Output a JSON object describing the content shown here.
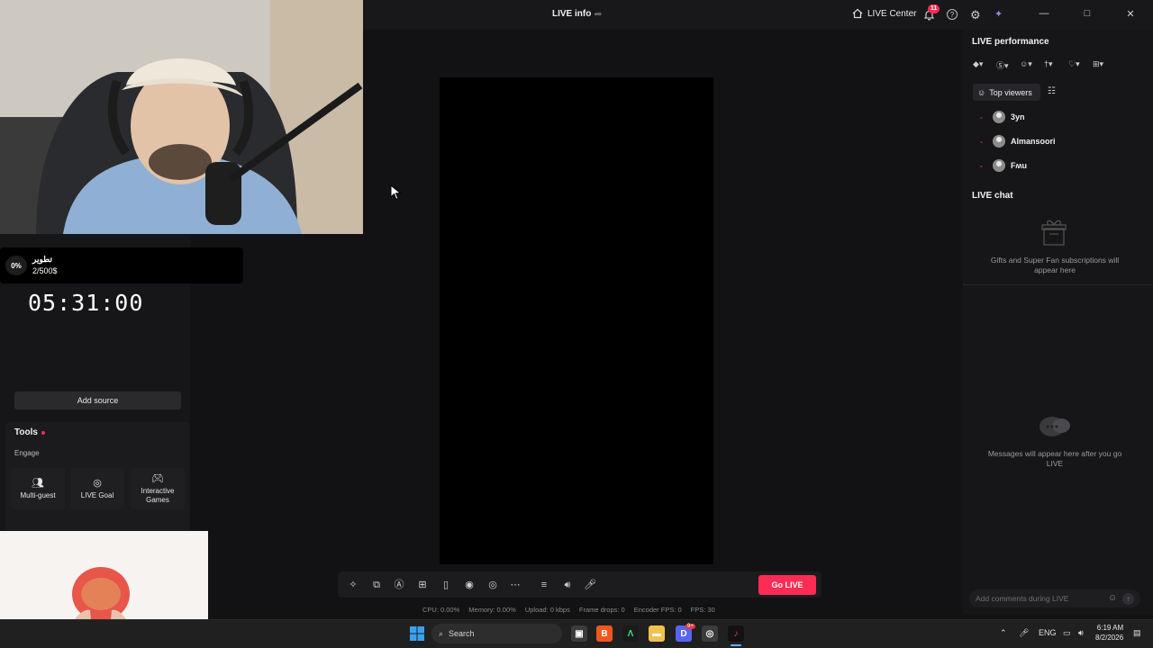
{
  "window": {
    "title": "LIVE info",
    "live_center_label": "LIVE Center",
    "notifications_count": "11"
  },
  "goal": {
    "percent": "0%",
    "name": "تطوير",
    "amount": "2/500$"
  },
  "timer": "05:31:00",
  "left_panel": {
    "add_source_label": "Add source",
    "tools_title": "Tools",
    "engage_label": "Engage",
    "tools": [
      {
        "label": "Multi-guest",
        "icon": "multi-guest-icon"
      },
      {
        "label": "LIVE Goal",
        "icon": "live-goal-icon"
      },
      {
        "label": "Interactive Games",
        "icon": "gamepad-icon"
      }
    ]
  },
  "toolbar": {
    "go_live_label": "Go LIVE",
    "stats": {
      "cpu": "CPU: 0.00%",
      "memory": "Memory: 0.00%",
      "upload": "Upload: 0 kbps",
      "frame_drops": "Frame drops: 0",
      "encoder_fps": "Encoder FPS: 0",
      "fps": "FPS: 30"
    }
  },
  "right_panel": {
    "performance_title": "LIVE performance",
    "top_viewers_label": "Top viewers",
    "viewers": [
      {
        "rank": "-",
        "name": "3yn"
      },
      {
        "rank": "-",
        "name": "Almansoori"
      },
      {
        "rank": "-",
        "name": "Fʍu"
      }
    ],
    "chat_title": "LIVE chat",
    "gifts_text": "Gifts and Super Fan subscriptions will appear here",
    "messages_text": "Messages will appear here after you go LIVE",
    "comment_placeholder": "Add comments during LIVE"
  },
  "taskbar": {
    "search_label": "Search",
    "language": "ENG",
    "time": "6:19 AM",
    "date": "8/2/2026",
    "discord_badge": "9+"
  },
  "colors": {
    "accent": "#fe2c55",
    "background": "#121214",
    "panel": "#161618"
  }
}
